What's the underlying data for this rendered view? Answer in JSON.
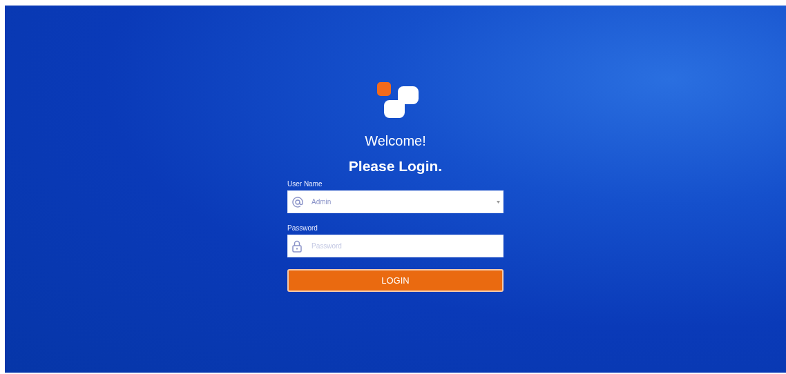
{
  "greeting": "Welcome!",
  "heading": "Please Login.",
  "fields": [
    {
      "kind": "username",
      "label": "User Name",
      "value": "Admin",
      "dropdown": true
    },
    {
      "kind": "password",
      "label": "Password",
      "placeholder": "Password",
      "dropdown": false
    }
  ],
  "button": "LOGIN"
}
